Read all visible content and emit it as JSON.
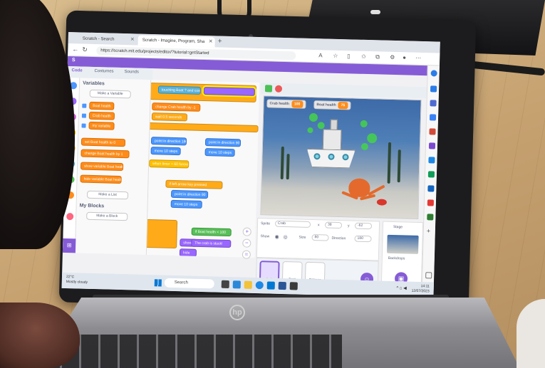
{
  "browser": {
    "tabs": [
      {
        "label": "Scratch - Search"
      },
      {
        "label": "Scratch - Imagine, Program, Sha"
      }
    ],
    "new_tab": "+",
    "url": "https://scratch.mit.edu/projects/editor/?tutorial=getStarted"
  },
  "scratch": {
    "editor_tabs": [
      "Code",
      "Costumes",
      "Sounds"
    ],
    "categories": [
      {
        "name": "motion",
        "color": "#4c97ff"
      },
      {
        "name": "looks",
        "color": "#9966ff"
      },
      {
        "name": "sound",
        "color": "#cf63cf"
      },
      {
        "name": "events",
        "color": "#ffbf00"
      },
      {
        "name": "control",
        "color": "#ffab19"
      },
      {
        "name": "sensing",
        "color": "#5cb1d6"
      },
      {
        "name": "operators",
        "color": "#59c059"
      },
      {
        "name": "variables",
        "color": "#ff8c1a"
      },
      {
        "name": "my-blocks",
        "color": "#ff6680"
      }
    ],
    "category_label_variables": "Variables",
    "category_label_myblocks": "My Blocks",
    "palette": {
      "variables_heading": "Variables",
      "make_variable": "Make a Variable",
      "variables": [
        "Boat health",
        "Crab health",
        "my variable"
      ],
      "set_block": "set Boat health to 0",
      "change_block": "change Boat health by 1",
      "show_block": "show variable Boat health",
      "hide_block": "hide variable Boat health",
      "make_list": "Make a List",
      "myblocks_heading": "My Blocks",
      "make_block": "Make a Block"
    },
    "code_blocks": [
      "touching Boat ? and costume name = Crab1",
      "change Crab health by -1",
      "wait 0.5 seconds",
      "point in direction 180",
      "move 10 steps",
      "point in direction 90",
      "move 10 steps",
      "when timer > 60 forever",
      "if left arrow key pressed",
      "point in direction 90",
      "move 10 steps",
      "if Boat health < 100",
      "show",
      "The crab is stuck!",
      "hide"
    ],
    "stage": {
      "monitors": [
        {
          "label": "Crab health",
          "value": "100"
        },
        {
          "label": "Boat health",
          "value": "75"
        }
      ]
    },
    "sprite_info": {
      "sprite_label": "Sprite",
      "sprite_name": "Crab",
      "x_label": "x",
      "x_value": "38",
      "y_label": "y",
      "y_value": "-62",
      "show_label": "Show",
      "size_label": "Size",
      "size_value": "80",
      "direction_label": "Direction",
      "direction_value": "180"
    },
    "sprites": [
      "Crab",
      "Boat",
      "Octopus"
    ],
    "stage_pane": {
      "label": "Stage",
      "backdrops_label": "Backdrops"
    }
  },
  "taskbar": {
    "weather_temp": "22°C",
    "weather_desc": "Mostly cloudy",
    "search": "Search",
    "time": "14:11",
    "date": "12/07/2023"
  },
  "device": {
    "brand": "hp"
  },
  "colors": {
    "scratch_purple": "#855cd6",
    "variable_orange": "#ff8c1a",
    "motion_blue": "#4c97ff",
    "control_yellow": "#ffab19"
  }
}
